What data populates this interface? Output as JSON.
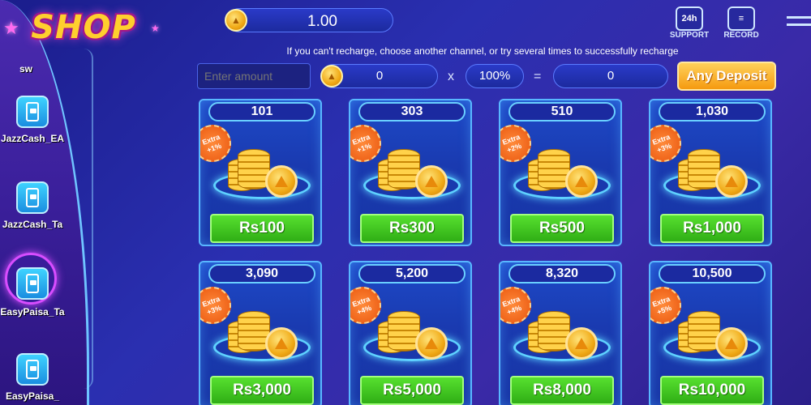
{
  "app": {
    "logo_text": "SHOP"
  },
  "sidebar": {
    "partial_label": "sw",
    "channels": [
      {
        "label": "JazzCash_EA"
      },
      {
        "label": "JazzCash_Ta"
      },
      {
        "label": "EasyPaisa_Ta",
        "active": true
      },
      {
        "label": "EasyPaisa_"
      }
    ]
  },
  "header": {
    "balance": "1.00",
    "support_label": "SUPPORT",
    "support_badge": "24h",
    "record_label": "RECORD"
  },
  "notice": "If you can't recharge, choose another channel, or try several times to successfully recharge",
  "deposit": {
    "amount_placeholder": "Enter amount",
    "coin_value": "0",
    "multiplier_sign": "x",
    "percent": "100%",
    "equals_sign": "=",
    "result": "0",
    "button_label": "Any Deposit"
  },
  "packages": [
    {
      "coins": "101",
      "extra": "Extra +1%",
      "price": "Rs100"
    },
    {
      "coins": "303",
      "extra": "Extra +1%",
      "price": "Rs300"
    },
    {
      "coins": "510",
      "extra": "Extra +2%",
      "price": "Rs500"
    },
    {
      "coins": "1,030",
      "extra": "Extra +3%",
      "price": "Rs1,000"
    },
    {
      "coins": "3,090",
      "extra": "Extra +3%",
      "price": "Rs3,000"
    },
    {
      "coins": "5,200",
      "extra": "Extra +4%",
      "price": "Rs5,000"
    },
    {
      "coins": "8,320",
      "extra": "Extra +4%",
      "price": "Rs8,000"
    },
    {
      "coins": "10,500",
      "extra": "Extra +5%",
      "price": "Rs10,000"
    }
  ],
  "colors": {
    "accent_green": "#3cc41e",
    "accent_orange": "#f59a10",
    "card_border": "#58b7ff"
  },
  "icons": {
    "coin": "coin-icon",
    "phone": "phone-wallet-icon",
    "support": "support-24h-icon",
    "record": "record-icon",
    "menu": "menu-icon"
  }
}
